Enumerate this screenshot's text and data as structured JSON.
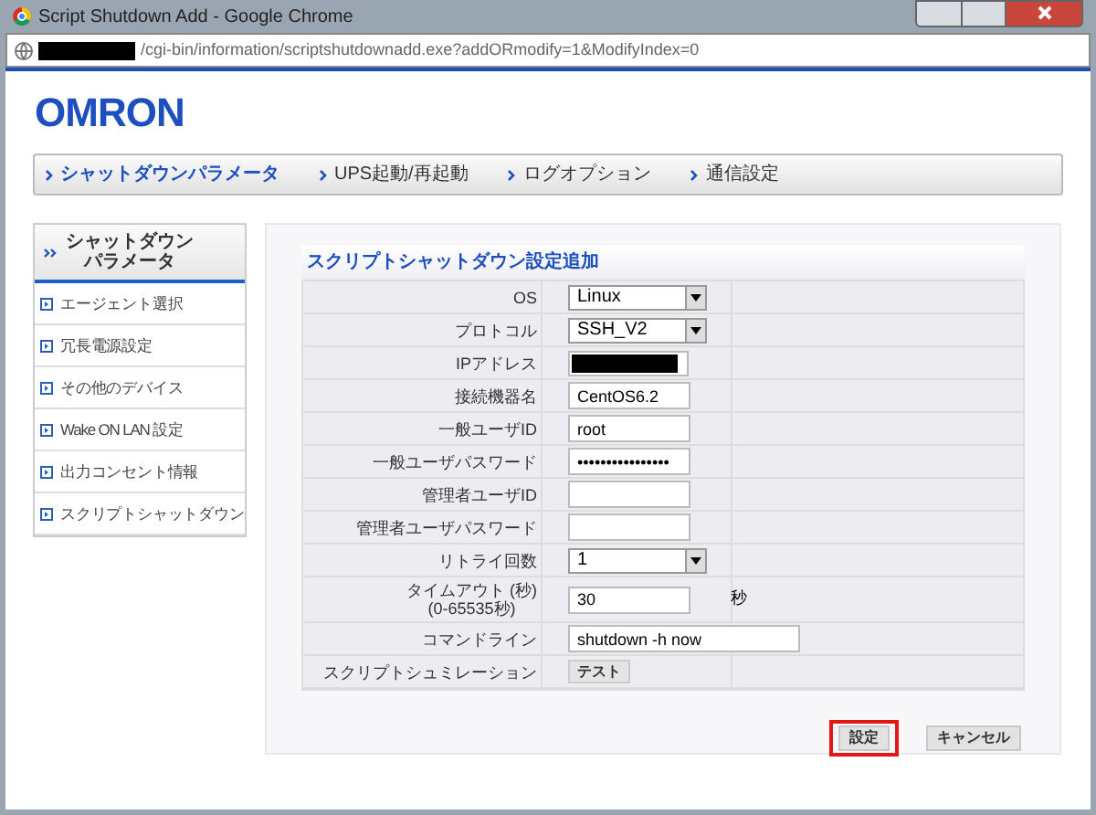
{
  "window": {
    "title": "Script Shutdown Add - Google Chrome",
    "url": "/cgi-bin/information/scriptshutdownadd.exe?addORmodify=1&ModifyIndex=0"
  },
  "logo": "OMRON",
  "nav": [
    {
      "label": "シャットダウンパラメータ",
      "selected": true
    },
    {
      "label": "UPS起動/再起動",
      "selected": false
    },
    {
      "label": "ログオプション",
      "selected": false
    },
    {
      "label": "通信設定",
      "selected": false
    }
  ],
  "sidebar": {
    "title": "シャットダウンパラメータ",
    "items": [
      "エージェント選択",
      "冗長電源設定",
      "その他のデバイス",
      "Wake ON LAN 設定",
      "出力コンセント情報",
      "スクリプトシャットダウン"
    ]
  },
  "form": {
    "title": "スクリプトシャットダウン設定追加",
    "rows": [
      {
        "label": "OS",
        "kind": "select",
        "value": "Linux"
      },
      {
        "label": "プロトコル",
        "kind": "select",
        "value": "SSH_V2"
      },
      {
        "label": "IPアドレス",
        "kind": "redacted"
      },
      {
        "label": "接続機器名",
        "kind": "text",
        "value": "CentOS6.2"
      },
      {
        "label": "一般ユーザID",
        "kind": "text",
        "value": "root"
      },
      {
        "label": "一般ユーザパスワード",
        "kind": "text",
        "value": "••••••••••••••••"
      },
      {
        "label": "管理者ユーザID",
        "kind": "text"
      },
      {
        "label": "管理者ユーザパスワード",
        "kind": "text"
      },
      {
        "label": "リトライ回数",
        "kind": "select",
        "value": "1"
      },
      {
        "label": "タイムアウト (秒)\n(0-65535秒)",
        "kind": "text",
        "value": "30",
        "suffix": "秒"
      },
      {
        "label": "コマンドライン",
        "kind": "wide",
        "value": "shutdown -h now"
      },
      {
        "label": "スクリプトシュミレーション",
        "kind": "button",
        "value": "テスト"
      }
    ],
    "buttons": [
      {
        "label": "設定",
        "focused": true
      },
      {
        "label": "キャンセル",
        "focused": false
      }
    ]
  }
}
